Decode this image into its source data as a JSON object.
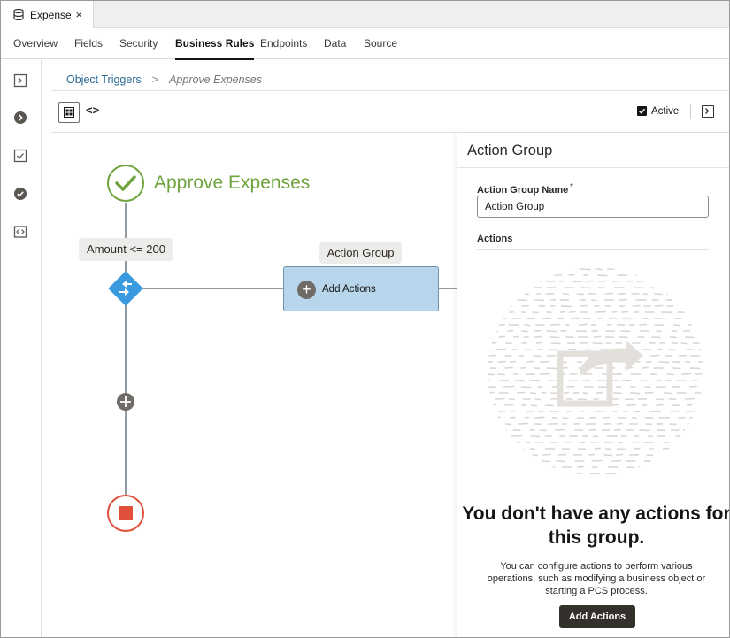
{
  "file_tab": {
    "label": "Expense",
    "icon": "database-icon"
  },
  "nav_tabs": [
    "Overview",
    "Fields",
    "Security",
    "Business Rules",
    "Endpoints",
    "Data",
    "Source"
  ],
  "nav_active": "Business Rules",
  "breadcrumb": {
    "parent": "Object Triggers",
    "separator": ">",
    "current": "Approve Expenses"
  },
  "toolbar": {
    "active_label": "Active",
    "active_checked": true,
    "code_glyph": "<>"
  },
  "flow": {
    "start_title": "Approve Expenses",
    "condition_label": "Amount <= 200",
    "action_group_label": "Action Group",
    "action_node_label": "Add Actions",
    "colors": {
      "start": "#6fa33d",
      "condition": "#3a9ae0",
      "end": "#e0503a",
      "node_fill": "#b7d6ec"
    }
  },
  "panel": {
    "title": "Action Group",
    "name_field_label": "Action Group Name",
    "name_field_required_mark": "*",
    "name_field_value": "Action Group",
    "actions_label": "Actions",
    "empty_title": "You don't have any actions for this group.",
    "empty_desc": "You can configure actions to perform various operations, such as modifying a business object or starting a PCS process.",
    "add_button_label": "Add Actions"
  }
}
